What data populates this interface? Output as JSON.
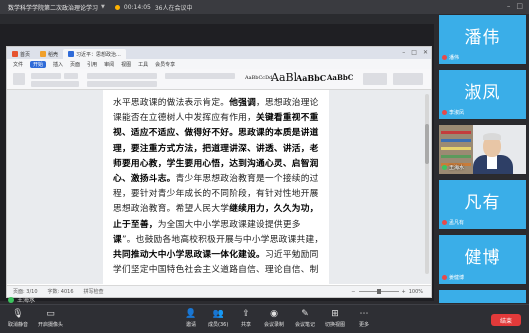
{
  "meeting": {
    "title": "数学科学学院第二次政治理论学习",
    "timer": "00:14:05",
    "participants": "36人在会议中"
  },
  "document": {
    "tabs": [
      "首页",
      "稻壳",
      "习近平：思想政治..."
    ],
    "menu": [
      "文件",
      "开始",
      "插入",
      "页面",
      "引用",
      "审阅",
      "视图",
      "工具",
      "会员专享"
    ],
    "styles": [
      "AaBbCcDd",
      "AaBl",
      "AaBbC",
      "AaBbC"
    ],
    "lines": [
      {
        "t": "水平思政课的做法表示肯定。",
        "b": "他强调",
        "r": "，思想政治理论"
      },
      {
        "t": "课能否在立德树人中发挥应有作用，",
        "b": "关键看重视不重",
        "r": ""
      },
      {
        "t": "",
        "b": "视、适应不适应、做得好不好。思政课的本质是讲道",
        "r": ""
      },
      {
        "t": "",
        "b": "理，要注重方式方法，把道理讲深、讲透、讲活，老",
        "r": ""
      },
      {
        "t": "",
        "b": "师要用心教，学生要用心悟，达到沟通心灵、启智润",
        "r": ""
      },
      {
        "t": "",
        "b": "心、激扬斗志。",
        "r": "青少年思想政治教育是一个接续的过"
      },
      {
        "t": "程，要针对青少年成长的不同阶段，有针对性地开展",
        "b": "",
        "r": ""
      },
      {
        "t": "思想政治教育。希望人民大学",
        "b": "继续用力，久久为功，",
        "r": ""
      },
      {
        "t": "",
        "b": "止于至善，",
        "r": "为全国大中小学思政课建设提供更多"
      },
      {
        "t": "",
        "b": "课",
        "r": "”。也鼓励各地高校积极开展与中小学思政课共建，"
      },
      {
        "t": "",
        "b": "共同推动大中小学思政课一体化建设。",
        "r": "习近平勉励同"
      },
      {
        "t": "学们坚定中国特色社会主义道路自信、理论自信、制",
        "b": "",
        "r": ""
      }
    ],
    "status_left": "页面: 3/10",
    "status_words": "字数: 4016",
    "status_mode": "拼写检查",
    "zoom": "100%"
  },
  "speaking": "王海水",
  "participants": [
    {
      "name": "潘伟",
      "label": "潘伟"
    },
    {
      "name": "淑凤",
      "label": "李淑凤"
    },
    {
      "name": "",
      "label": "王海水"
    },
    {
      "name": "凡有",
      "label": "孟凡有"
    },
    {
      "name": "健博",
      "label": "姜健博"
    },
    {
      "name": "",
      "label": ""
    }
  ],
  "toolbar": {
    "mute": "取消静音",
    "camera": "开启摄像头",
    "invite": "邀请",
    "members": "成员(36)",
    "share": "共享",
    "record": "会议录制",
    "notes": "会议笔记",
    "layout": "切换视图",
    "more": "更多",
    "end": "结束"
  },
  "colors": {
    "tile_blue": "#3aaee8",
    "end_red": "#e23a3a",
    "accent_blue": "#2f6bd8"
  }
}
